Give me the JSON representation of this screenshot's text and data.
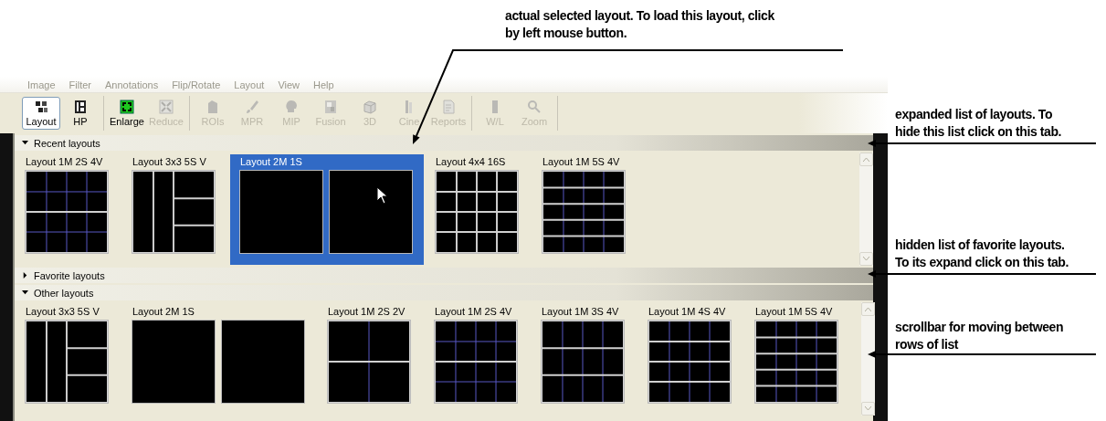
{
  "menu": [
    "Image",
    "Filter",
    "Annotations",
    "Flip/Rotate",
    "Layout",
    "View",
    "Help"
  ],
  "toolbar": {
    "groups": [
      [
        {
          "label": "Layout",
          "selected": true,
          "disabled": false
        },
        {
          "label": "HP",
          "selected": false,
          "disabled": false
        }
      ],
      [
        {
          "label": "Enlarge",
          "selected": false,
          "disabled": false
        },
        {
          "label": "Reduce",
          "selected": false,
          "disabled": true
        }
      ],
      [
        {
          "label": "ROIs",
          "selected": false,
          "disabled": true
        },
        {
          "label": "MPR",
          "selected": false,
          "disabled": true
        },
        {
          "label": "MIP",
          "selected": false,
          "disabled": true
        },
        {
          "label": "Fusion",
          "selected": false,
          "disabled": true
        },
        {
          "label": "3D",
          "selected": false,
          "disabled": true
        },
        {
          "label": "Cine",
          "selected": false,
          "disabled": true
        },
        {
          "label": "Reports",
          "selected": false,
          "disabled": true
        }
      ],
      [
        {
          "label": "W/L",
          "selected": false,
          "disabled": true
        },
        {
          "label": "Zoom",
          "selected": false,
          "disabled": true
        }
      ]
    ]
  },
  "sections": [
    {
      "title": "Recent layouts",
      "expanded": true,
      "layouts": [
        {
          "name": "Layout 1M 2S 4V",
          "kind": "twobands",
          "selected": false
        },
        {
          "name": "Layout 3x3 5S V",
          "kind": "columns",
          "selected": false
        },
        {
          "name": "Layout 2M 1S",
          "kind": "double",
          "selected": true
        },
        {
          "name": "Layout 4x4 16S",
          "kind": "sixteen",
          "selected": false
        },
        {
          "name": "Layout 1M 5S 4V",
          "kind": "fiverows",
          "selected": false
        }
      ]
    },
    {
      "title": "Favorite layouts",
      "expanded": false
    },
    {
      "title": "Other layouts",
      "expanded": true,
      "layouts": [
        {
          "name": "Layout 3x3 5S V",
          "kind": "columns",
          "selected": false
        },
        {
          "name": "Layout 2M 1S",
          "kind": "double",
          "selected": false
        },
        {
          "name": "Layout 1M 2S 2V",
          "kind": "halves",
          "selected": false
        },
        {
          "name": "Layout 1M 2S 4V",
          "kind": "twobands",
          "selected": false
        },
        {
          "name": "Layout 1M 3S 4V",
          "kind": "threerows",
          "selected": false
        },
        {
          "name": "Layout 1M 4S 4V",
          "kind": "fourrows",
          "selected": false
        },
        {
          "name": "Layout 1M 5S 4V",
          "kind": "fiverows",
          "selected": false
        }
      ]
    }
  ],
  "annotations": [
    {
      "text": "actual selected layout. To load this layout, click\nby left mouse button."
    },
    {
      "text": "expanded list of layouts. To\nhide this list click on this tab."
    },
    {
      "text": "hidden list of favorite layouts.\nTo its expand click on this tab."
    },
    {
      "text": "scrollbar for moving between\nrows of list"
    }
  ]
}
